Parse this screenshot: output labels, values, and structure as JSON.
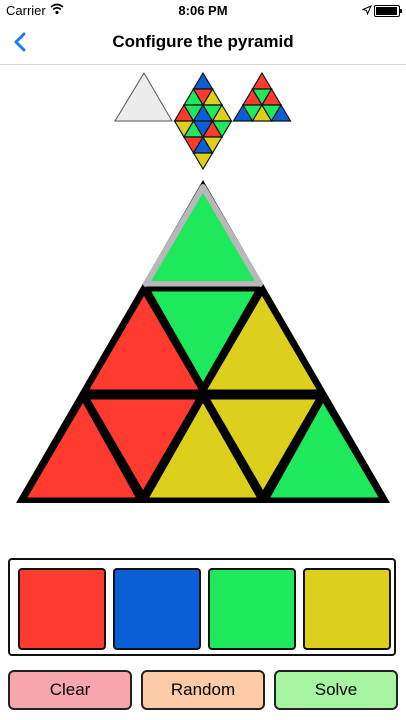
{
  "status_bar": {
    "carrier": "Carrier",
    "time": "8:06 PM"
  },
  "nav": {
    "title": "Configure the pyramid"
  },
  "colors": {
    "red": "#ff3b30",
    "blue": "#0a5ed6",
    "green": "#1ee85b",
    "yellow": "#dcd01d",
    "accent": "#1a7cf5"
  },
  "palette": [
    {
      "name": "red",
      "color": "#ff3b30"
    },
    {
      "name": "blue",
      "color": "#0a5ed6"
    },
    {
      "name": "green",
      "color": "#1ee85b"
    },
    {
      "name": "yellow",
      "color": "#dcd01d"
    }
  ],
  "buttons": {
    "clear": "Clear",
    "random": "Random",
    "solve": "Solve"
  }
}
